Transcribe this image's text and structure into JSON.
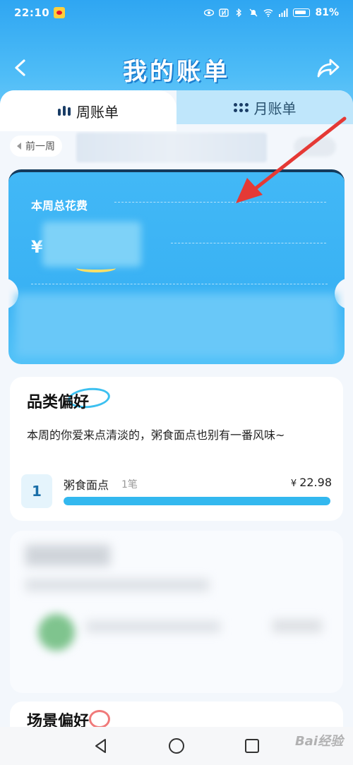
{
  "status_bar": {
    "time": "22:10",
    "battery": "81%"
  },
  "nav": {
    "title": "我的账单"
  },
  "tabs": {
    "week_label": "周账单",
    "month_label": "月账单",
    "active": "week"
  },
  "week_selector": {
    "prev_label": "前一周"
  },
  "spend_card": {
    "title": "本周总花费",
    "currency_symbol": "¥"
  },
  "category_card": {
    "title": "品类偏好",
    "description": "本周的你爱来点清淡的，粥食面点也别有一番风味~",
    "items": [
      {
        "rank": "1",
        "name": "粥食面点",
        "count": "1笔",
        "currency": "¥",
        "amount": "22.98",
        "share": 1.0
      }
    ]
  },
  "scene_card": {
    "title": "场景偏好"
  },
  "watermark": "Bai经验",
  "colors": {
    "accent_blue": "#33b8ef",
    "header_blue": "#2fa6f2",
    "annotation_red": "#e53935"
  }
}
